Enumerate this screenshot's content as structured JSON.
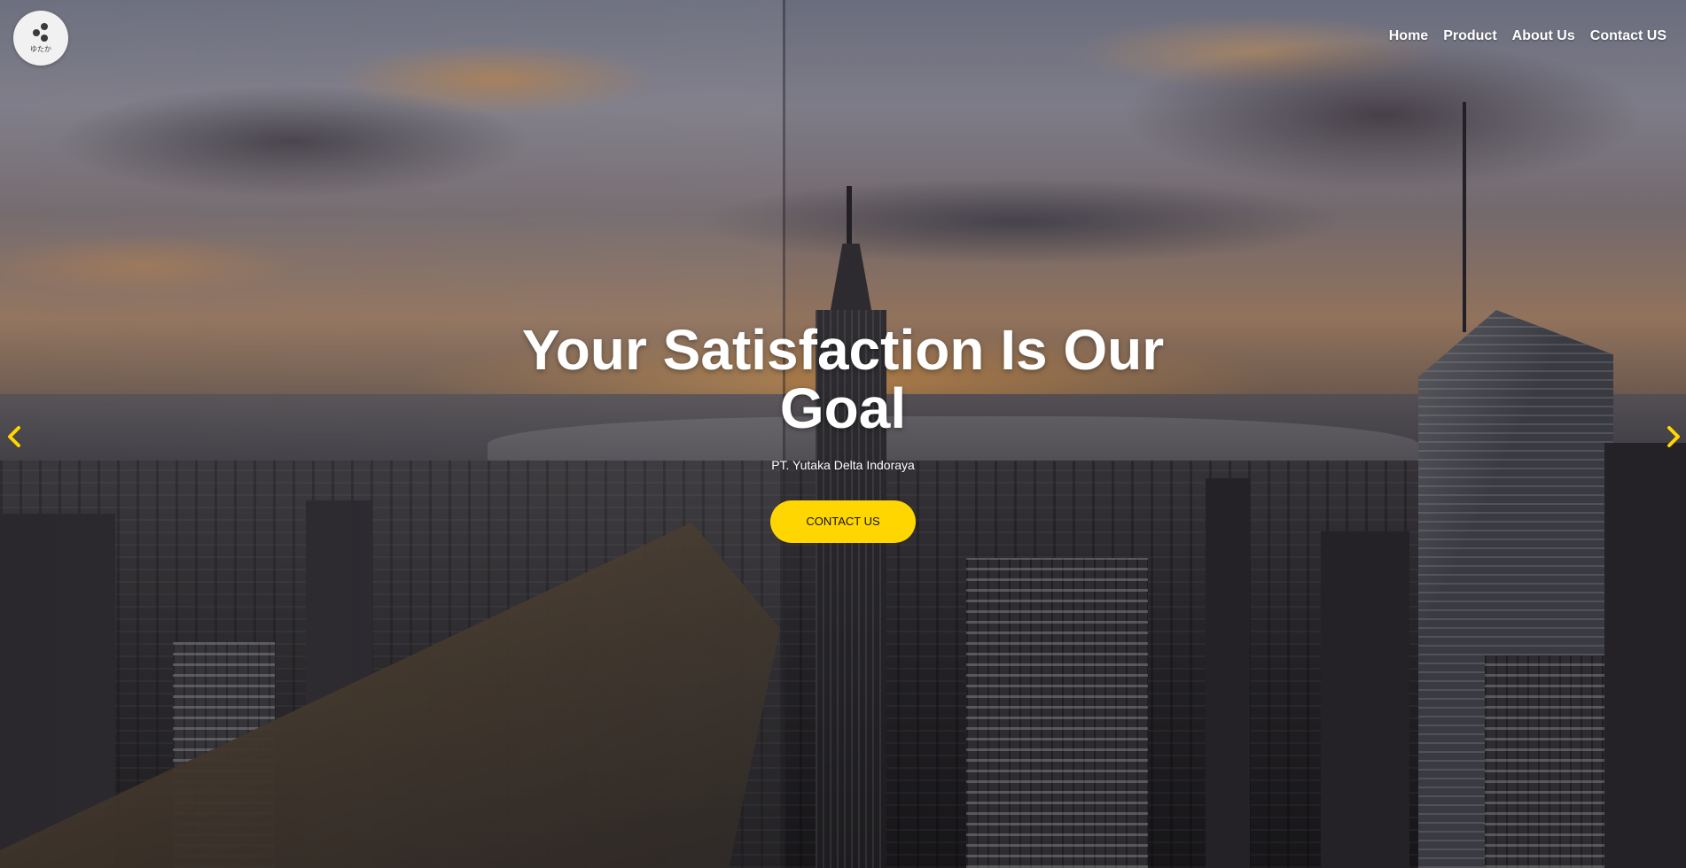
{
  "logo": {
    "text": "ゆたか"
  },
  "nav": {
    "items": [
      {
        "label": "Home"
      },
      {
        "label": "Product"
      },
      {
        "label": "About Us"
      },
      {
        "label": "Contact US"
      }
    ]
  },
  "hero": {
    "title": "Your Satisfaction Is Our Goal",
    "subtitle": "PT. Yutaka Delta Indoraya",
    "cta_label": "CONTACT US"
  },
  "carousel": {
    "prev_icon": "chevron-left-icon",
    "next_icon": "chevron-right-icon"
  },
  "colors": {
    "accent": "#ffd600",
    "nav_text": "#ffffff",
    "arrow": "#ffd600"
  }
}
